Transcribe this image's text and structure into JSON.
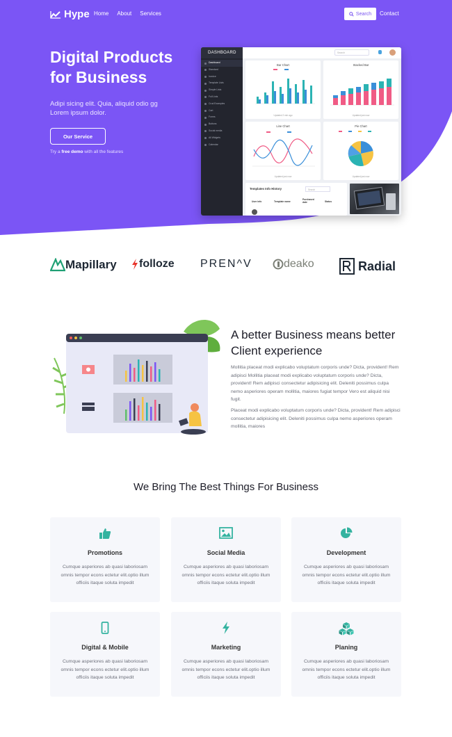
{
  "nav": {
    "logo_text": "Hype",
    "links": [
      "Home",
      "About",
      "Services"
    ],
    "search_label": "Search",
    "contact_label": "Contact"
  },
  "hero": {
    "title": "Digital Products for Business",
    "subtitle": "Adipi sicing elit. Quia, aliquid odio gg Lorem ipsum dolor.",
    "button_label": "Our Service",
    "note_prefix": "Try a",
    "note_bold": "free demo",
    "note_suffix": "with all the features"
  },
  "dashboard": {
    "sidebar_title": "DASHBOARD",
    "sidebar_items": [
      "Dashboard",
      "Standard",
      "Invoice",
      "Template Lists",
      "Simple Lists",
      "Full Lists",
      "Crud Examples",
      "Cart",
      "Forms",
      "Buttons",
      "Social media",
      "All Widgets",
      "Calendar"
    ],
    "search_placeholder": "Search",
    "cards": [
      {
        "title": "Bar Chart",
        "foot": "Updated 2 min ago"
      },
      {
        "title": "Stacked Bar",
        "foot": "Updated just now"
      },
      {
        "title": "Line Chart",
        "foot": "Updated just now"
      },
      {
        "title": "Pie Chart",
        "foot": "Updated just now"
      }
    ],
    "table_title": "Templates Info History",
    "table_search": "Search",
    "table_headers": [
      "User info",
      "Template name",
      "Purchased date",
      "Status"
    ],
    "colors": {
      "sidebar": "#23252e",
      "teal": "#2bb3b3",
      "blue": "#3a8fd9",
      "pink": "#f05b85",
      "yellow": "#f6c343"
    }
  },
  "logos": [
    {
      "name": "Mapillary",
      "icon": "mapillary-icon"
    },
    {
      "name": "folloze",
      "icon": "folloze-icon"
    },
    {
      "name": "PREN^V",
      "icon": ""
    },
    {
      "name": "deako",
      "icon": "deako-icon"
    },
    {
      "name": "Radial",
      "icon": "radial-icon"
    }
  ],
  "feature": {
    "title": "A better Business means better Client experience",
    "paragraph1": "Mollitia placeat modi explicabo voluptatum corporis unde? Dicta, provident! Rem adipisci Mollitia placeat modi explicabo voluptatum corporis unde? Dicta, provident! Rem adipisci consectetur adipisicing elit. Deleniti possimus culpa nemo asperiores operam mollitia, maiores fugiat tempor Vero est aliquid nisi fugit.",
    "paragraph2": "Placeat modi explicabo voluptatum corporis unde? Dicta, provident! Rem adipisci consectetur adipisicing elit. Deleniti possimus culpa nemo asperiores operam mollitia, maiores"
  },
  "services": {
    "title": "We Bring The Best Things For Business",
    "accent_color": "#34b3a0",
    "items": [
      {
        "title": "Promotions",
        "icon": "thumbs-up-icon",
        "text": "Cumque asperiores ab quasi laboriosam omnis tempor econs ectetur elit.optio illum officiis itaque soluta impedit"
      },
      {
        "title": "Social Media",
        "icon": "image-icon",
        "text": "Cumque asperiores ab quasi laboriosam omnis tempor econs ectetur elit.optio illum officiis itaque soluta impedit"
      },
      {
        "title": "Development",
        "icon": "pie-chart-icon",
        "text": "Cumque asperiores ab quasi laboriosam omnis tempor econs ectetur elit.optio illum officiis itaque soluta impedit"
      },
      {
        "title": "Digital & Mobile",
        "icon": "mobile-icon",
        "text": "Cumque asperiores ab quasi laboriosam omnis tempor econs ectetur elit.optio illum officiis itaque soluta impedit"
      },
      {
        "title": "Marketing",
        "icon": "bolt-icon",
        "text": "Cumque asperiores ab quasi laboriosam omnis tempor econs ectetur elit.optio illum officiis itaque soluta impedit"
      },
      {
        "title": "Planing",
        "icon": "cubes-icon",
        "text": "Cumque asperiores ab quasi laboriosam omnis tempor econs ectetur elit.optio illum officiis itaque soluta impedit"
      }
    ]
  },
  "theme": {
    "primary": "#7b55f5",
    "heading": "#1d1d28",
    "body_text": "#6c6f7a"
  }
}
